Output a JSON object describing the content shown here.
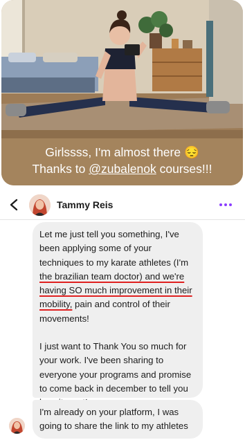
{
  "story": {
    "caption_line1": "Girlssss, I'm almost there",
    "emoji": "😔",
    "caption_line2_prefix": "Thanks to ",
    "mention": "@zubalenok",
    "caption_line2_suffix": " courses!!!"
  },
  "header": {
    "back_icon": "chevron-left",
    "contact_name": "Tammy Reis",
    "more_icon": "more-dots",
    "accent_color": "#8b3dff"
  },
  "messages": [
    {
      "t1": "Let me just tell you something,  I've been applying some of your techniques to my karate athletes (I'm ",
      "h1": "the brazilian team doctor) and we're having SO much improvement in their mobility,",
      "t2": " pain and control of their movements!",
      "p2": "I just want to Thank You so much for your work. I've been sharing to everyone your programs and promise to come back in december to tell you how it went!"
    },
    {
      "text": "I'm already on your platform, I was going to share the link to my athletes"
    }
  ],
  "colors": {
    "highlight": "#e0201f",
    "bubble": "#efefef"
  }
}
